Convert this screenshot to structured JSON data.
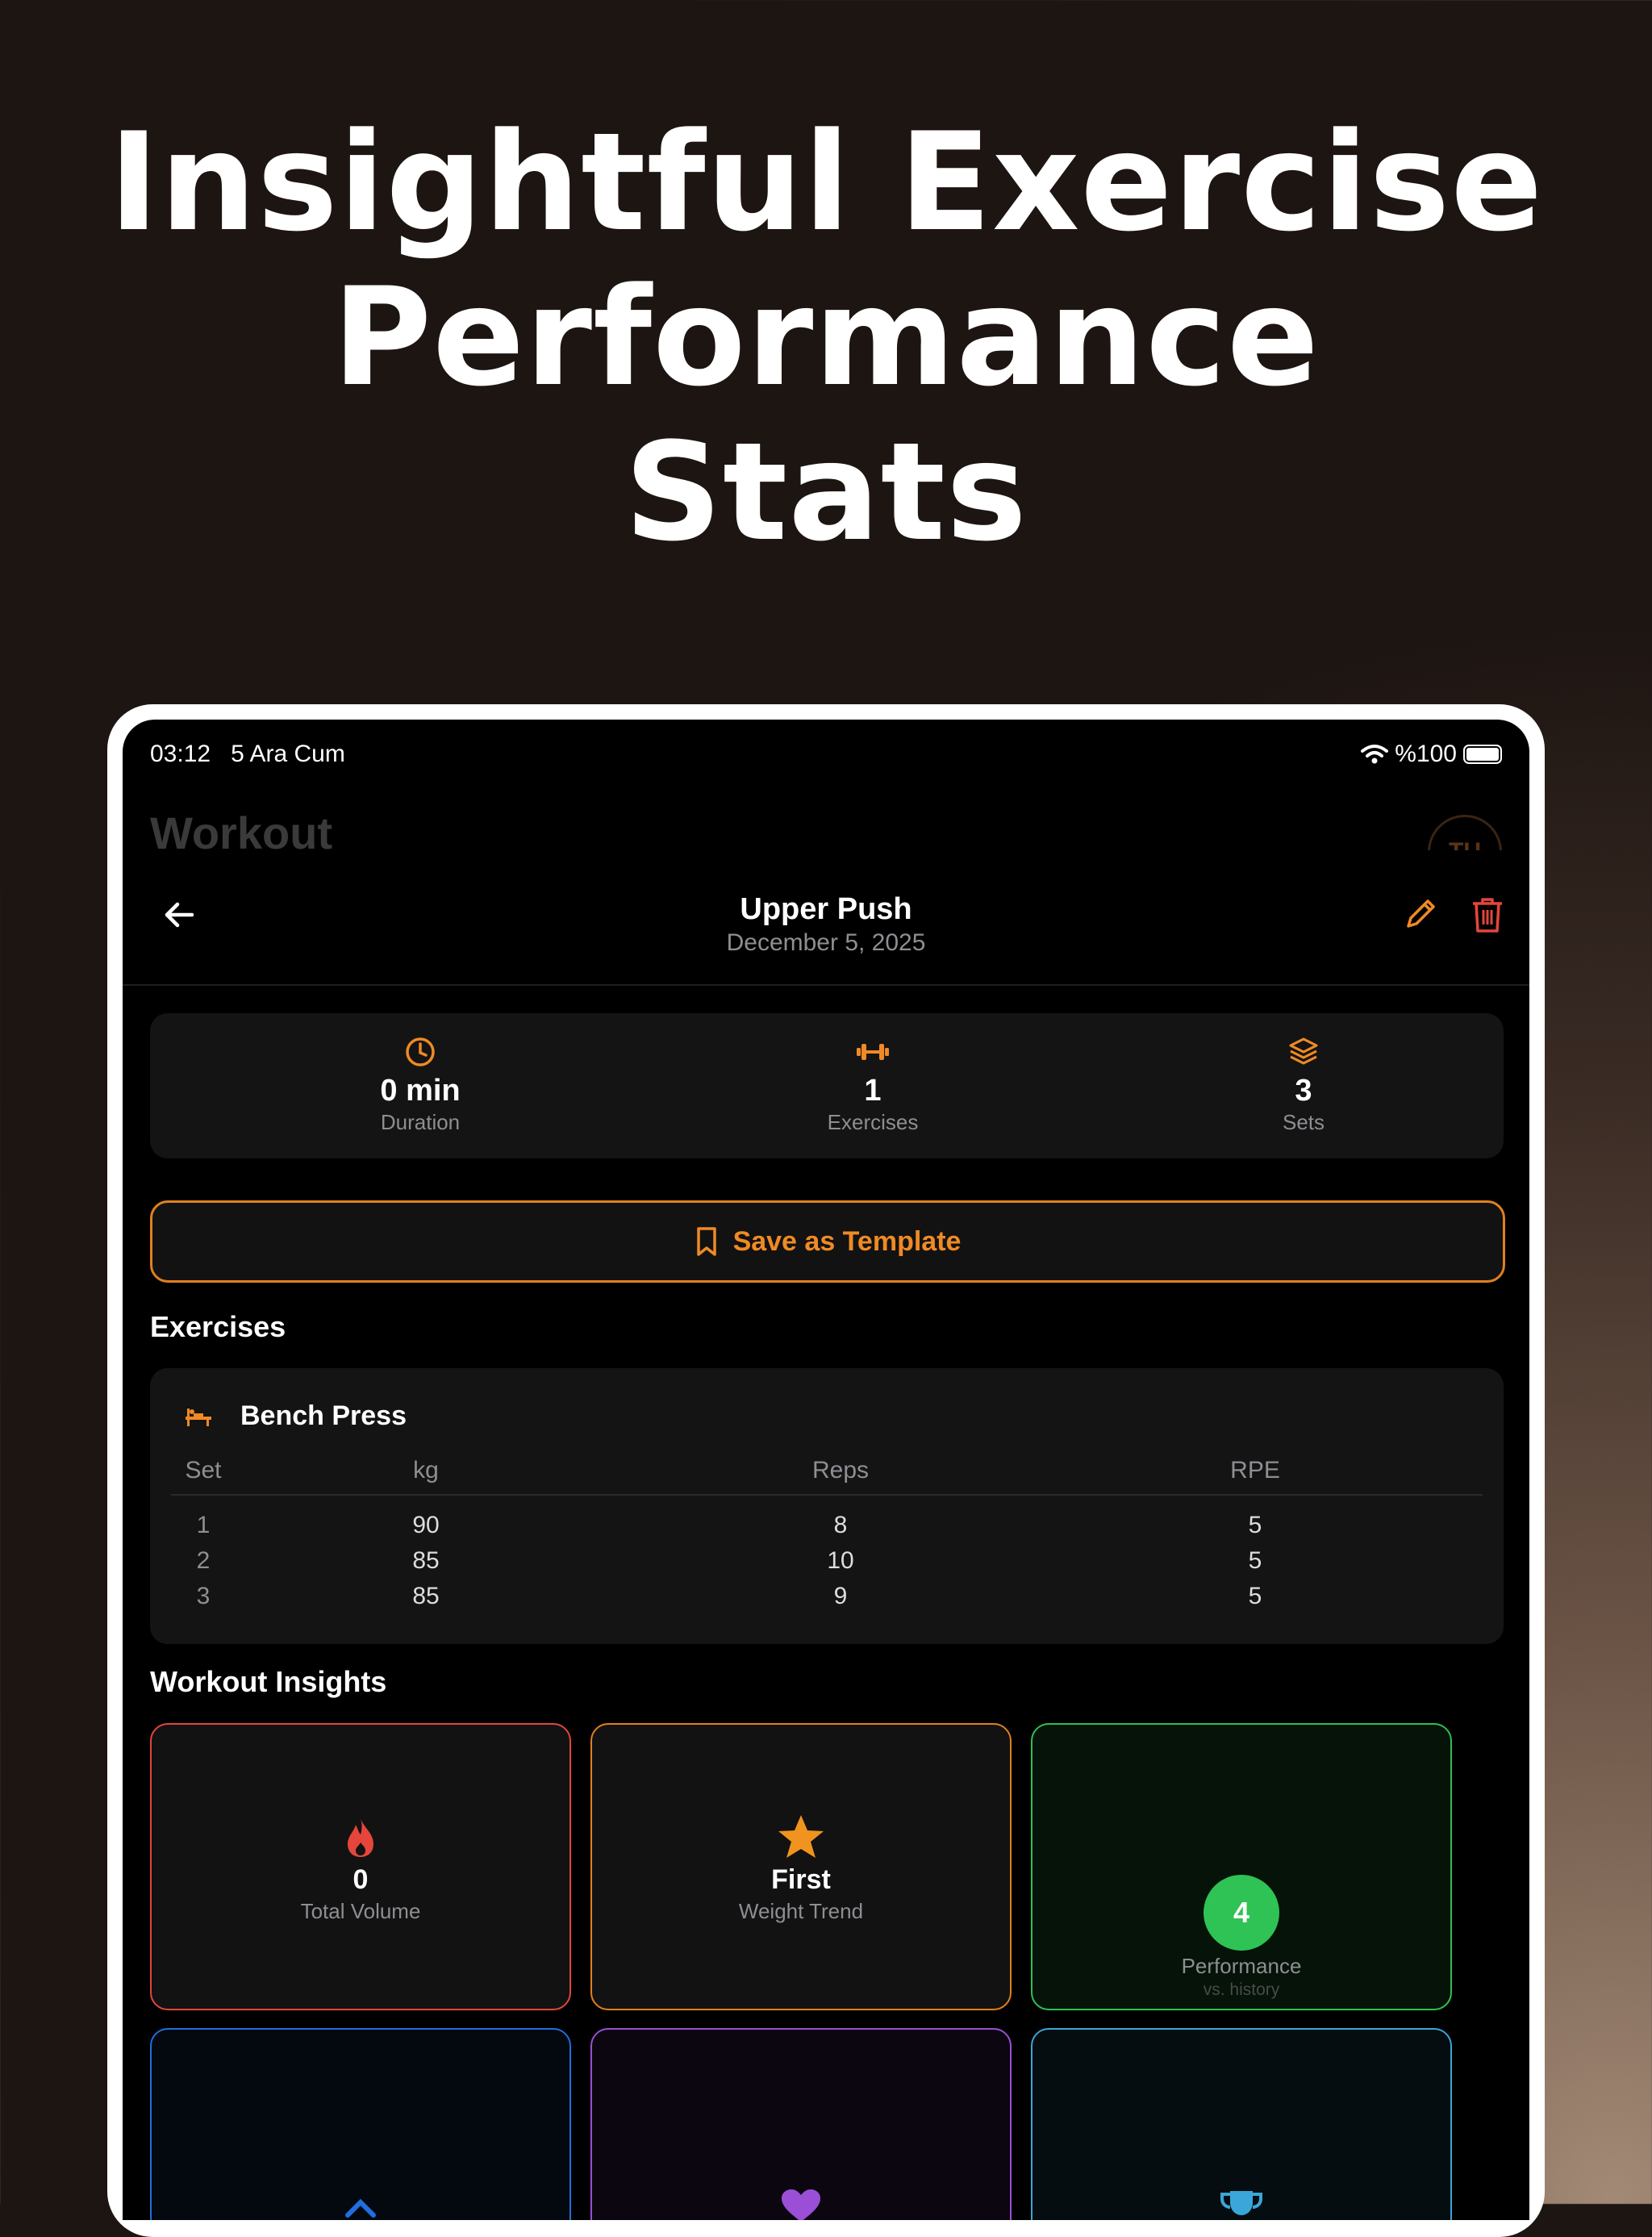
{
  "headline": {
    "line1": "Insightful Exercise",
    "line2": "Performance",
    "line3": "Stats"
  },
  "status_bar": {
    "time": "03:12",
    "date": "5 Ara Cum",
    "battery": "%100"
  },
  "background": {
    "title": "Workout",
    "avatar": "TU"
  },
  "nav": {
    "title": "Upper Push",
    "date": "December 5, 2025"
  },
  "summary": [
    {
      "icon": "clock-icon",
      "value": "0 min",
      "label": "Duration"
    },
    {
      "icon": "dumbbell-icon",
      "value": "1",
      "label": "Exercises"
    },
    {
      "icon": "layers-icon",
      "value": "3",
      "label": "Sets"
    }
  ],
  "save_button": {
    "label": "Save as Template"
  },
  "exercises_section": {
    "title": "Exercises"
  },
  "exercise": {
    "name": "Bench Press",
    "headers": {
      "set": "Set",
      "kg": "kg",
      "reps": "Reps",
      "rpe": "RPE"
    },
    "rows": [
      {
        "set": "1",
        "kg": "90",
        "reps": "8",
        "rpe": "5"
      },
      {
        "set": "2",
        "kg": "85",
        "reps": "10",
        "rpe": "5"
      },
      {
        "set": "3",
        "kg": "85",
        "reps": "9",
        "rpe": "5"
      }
    ]
  },
  "insights_section": {
    "title": "Workout Insights"
  },
  "insights": [
    {
      "icon": "flame-icon",
      "value": "0",
      "label": "Total Volume",
      "color": "#e5453b"
    },
    {
      "icon": "star-icon",
      "value": "First",
      "label": "Weight Trend",
      "color": "#e0801f"
    },
    {
      "icon": "score-circle",
      "value": "4",
      "label": "Performance",
      "sublabel": "vs. history",
      "color": "#2fbf55"
    },
    {
      "icon": "dumbbell-icon",
      "color": "#1f6fe0"
    },
    {
      "icon": "heart-icon",
      "color": "#9a4fd6"
    },
    {
      "icon": "trophy-icon",
      "color": "#3aa6d9"
    }
  ],
  "colors": {
    "accent": "#f08a24",
    "danger": "#e5453b"
  }
}
